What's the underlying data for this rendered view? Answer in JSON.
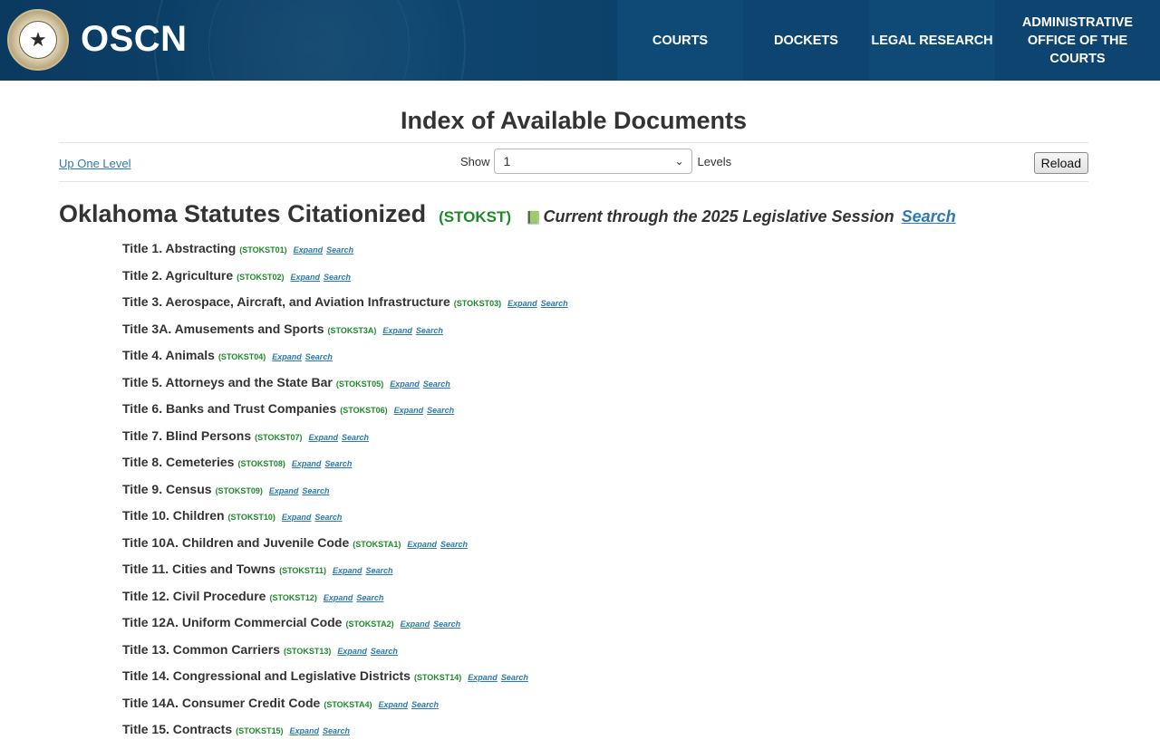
{
  "header": {
    "brand": "OSCN",
    "nav": [
      {
        "label": "COURTS"
      },
      {
        "label": "DOCKETS"
      },
      {
        "label": "LEGAL RESEARCH"
      },
      {
        "label": "ADMINISTRATIVE OFFICE OF THE COURTS"
      }
    ]
  },
  "page": {
    "title": "Index of Available Documents",
    "up_link": "Up One Level",
    "show_label": "Show",
    "levels_value": "1",
    "levels_label": "Levels",
    "reload_label": "Reload"
  },
  "section": {
    "heading": "Oklahoma Statutes Citationized",
    "code": "(STOKST)",
    "current": "Current through the 2025 Legislative Session",
    "search": "Search"
  },
  "links": {
    "expand": "Expand",
    "search": "Search"
  },
  "titles": [
    {
      "name": "Title 1. Abstracting",
      "code": "(STOKST01)"
    },
    {
      "name": "Title 2. Agriculture",
      "code": "(STOKST02)"
    },
    {
      "name": "Title 3. Aerospace, Aircraft, and Aviation Infrastructure",
      "code": "(STOKST03)"
    },
    {
      "name": "Title 3A. Amusements and Sports",
      "code": "(STOKST3A)"
    },
    {
      "name": "Title 4. Animals",
      "code": "(STOKST04)"
    },
    {
      "name": "Title 5. Attorneys and the State Bar",
      "code": "(STOKST05)"
    },
    {
      "name": "Title 6. Banks and Trust Companies",
      "code": "(STOKST06)"
    },
    {
      "name": "Title 7. Blind Persons",
      "code": "(STOKST07)"
    },
    {
      "name": "Title 8. Cemeteries",
      "code": "(STOKST08)"
    },
    {
      "name": "Title 9. Census",
      "code": "(STOKST09)"
    },
    {
      "name": "Title 10. Children",
      "code": "(STOKST10)"
    },
    {
      "name": "Title 10A. Children and Juvenile Code",
      "code": "(STOKSTA1)"
    },
    {
      "name": "Title 11. Cities and Towns",
      "code": "(STOKST11)"
    },
    {
      "name": "Title 12. Civil Procedure",
      "code": "(STOKST12)"
    },
    {
      "name": "Title 12A. Uniform Commercial Code",
      "code": "(STOKSTA2)"
    },
    {
      "name": "Title 13. Common Carriers",
      "code": "(STOKST13)"
    },
    {
      "name": "Title 14. Congressional and Legislative Districts",
      "code": "(STOKST14)"
    },
    {
      "name": "Title 14A. Consumer Credit Code",
      "code": "(STOKSTA4)"
    },
    {
      "name": "Title 15. Contracts",
      "code": "(STOKST15)"
    }
  ],
  "colors": {
    "header_bg": "#0e4670",
    "link": "#2a7ab5",
    "code_green": "#1e8a2a"
  }
}
